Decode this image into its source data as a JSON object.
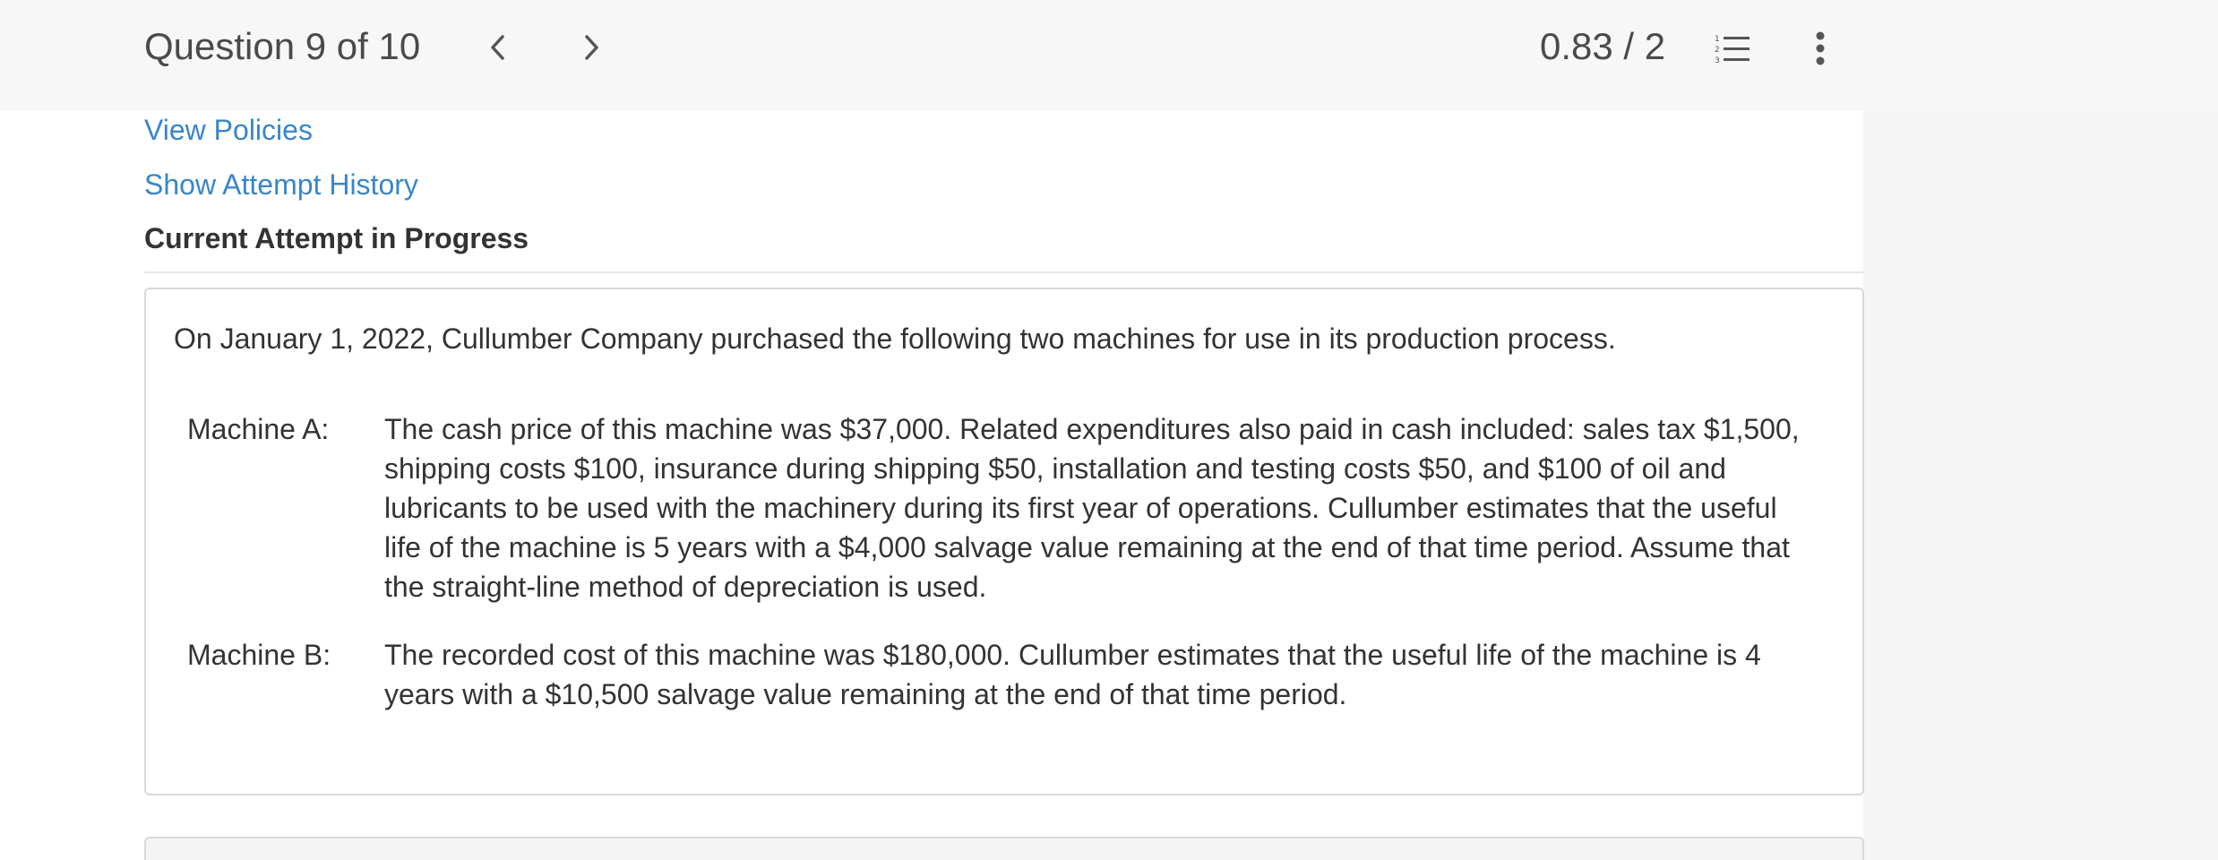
{
  "header": {
    "question_counter": "Question 9 of 10",
    "score": "0.83 / 2",
    "prev_icon": "chevron-left-icon",
    "next_icon": "chevron-right-icon",
    "list_icon": "numbered-list-icon",
    "more_icon": "more-vertical-icon"
  },
  "links": {
    "view_policies": "View Policies",
    "show_attempt_history": "Show Attempt History"
  },
  "attempt_status": "Current Attempt in Progress",
  "question": {
    "intro": "On January 1, 2022, Cullumber Company purchased the following two machines for use in its production process.",
    "machines": [
      {
        "label": "Machine A:",
        "text": "The cash price of this machine was $37,000. Related expenditures also paid in cash included: sales tax $1,500, shipping costs $100, insurance during shipping $50, installation and testing costs $50, and $100 of oil and lubricants to be used with the machinery during its first year of operations. Cullumber estimates that the useful life of the machine is 5 years with a $4,000 salvage value remaining at the end of that time period. Assume that the straight-line method of depreciation is used."
      },
      {
        "label": "Machine B:",
        "text": "The recorded cost of this machine was $180,000. Cullumber estimates that the useful life of the machine is 4 years with a $10,500 salvage value remaining at the end of that time period."
      }
    ]
  },
  "colors": {
    "link": "#3a86c8",
    "text": "#333333",
    "header_bg": "#f7f7f7",
    "border": "#d9d9d9"
  }
}
